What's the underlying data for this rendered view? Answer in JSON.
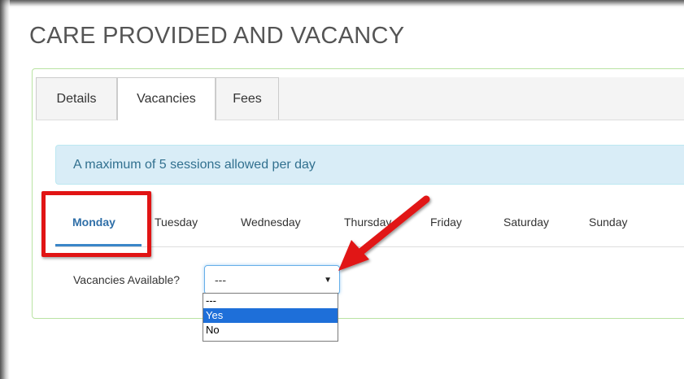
{
  "page": {
    "title": "CARE PROVIDED AND VACANCY"
  },
  "tabs": [
    {
      "label": "Details",
      "active": false
    },
    {
      "label": "Vacancies",
      "active": true
    },
    {
      "label": "Fees",
      "active": false
    }
  ],
  "alert": {
    "text": "A maximum of 5 sessions allowed per day"
  },
  "days": [
    {
      "label": "Monday",
      "active": true
    },
    {
      "label": "Tuesday",
      "active": false
    },
    {
      "label": "Wednesday",
      "active": false
    },
    {
      "label": "Thursday",
      "active": false
    },
    {
      "label": "Friday",
      "active": false
    },
    {
      "label": "Saturday",
      "active": false
    },
    {
      "label": "Sunday",
      "active": false
    }
  ],
  "vacancies": {
    "label": "Vacancies Available?",
    "selected_value": "---",
    "options": [
      "---",
      "Yes",
      "No"
    ],
    "highlighted_option": "Yes"
  },
  "annotations": {
    "highlight_color": "#e11414",
    "arrow_color": "#e11414"
  },
  "colors": {
    "accent": "#3a86c8",
    "alert_bg": "#d9edf7",
    "alert_text": "#31708f",
    "panel_border": "#b9e3a3"
  }
}
